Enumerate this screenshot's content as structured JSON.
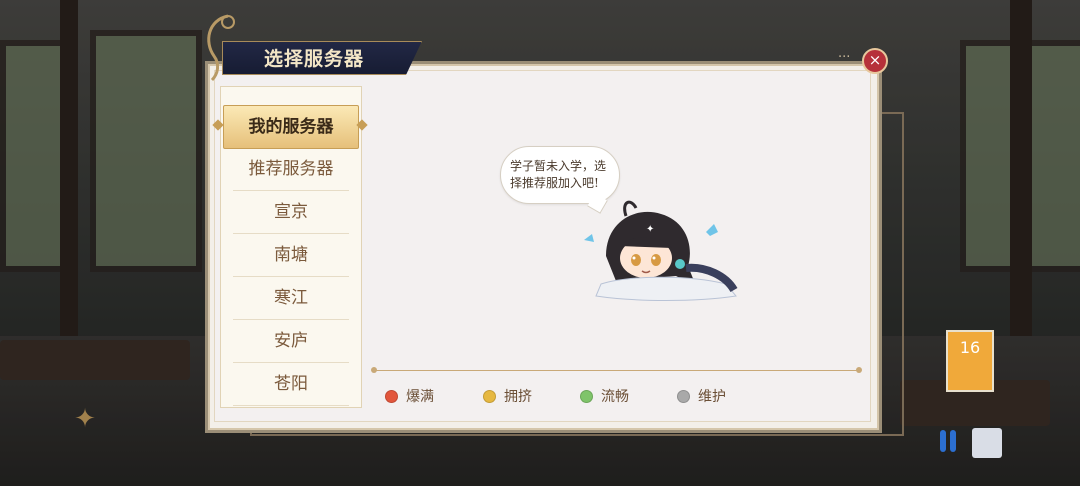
{
  "dialog": {
    "title": "选择服务器",
    "close_icon": "close-icon",
    "close_label": "×"
  },
  "sidebar": {
    "items": [
      {
        "label": "我的服务器",
        "active": true
      },
      {
        "label": "推荐服务器",
        "active": false
      },
      {
        "label": "宣京",
        "active": false
      },
      {
        "label": "南塘",
        "active": false
      },
      {
        "label": "寒江",
        "active": false
      },
      {
        "label": "安庐",
        "active": false
      },
      {
        "label": "苍阳",
        "active": false
      }
    ]
  },
  "content": {
    "bubble_text": "学子暂未入学，选择推荐服加入吧!"
  },
  "legend": [
    {
      "label": "爆满",
      "color": "#e2563c"
    },
    {
      "label": "拥挤",
      "color": "#e6b841"
    },
    {
      "label": "流畅",
      "color": "#7fc46a"
    },
    {
      "label": "维护",
      "color": "#a9a9a9"
    }
  ],
  "background": {
    "card_text": "16"
  },
  "colors": {
    "accent": "#c9a978",
    "title_bg": "#1c2140",
    "close": "#b6313a"
  }
}
